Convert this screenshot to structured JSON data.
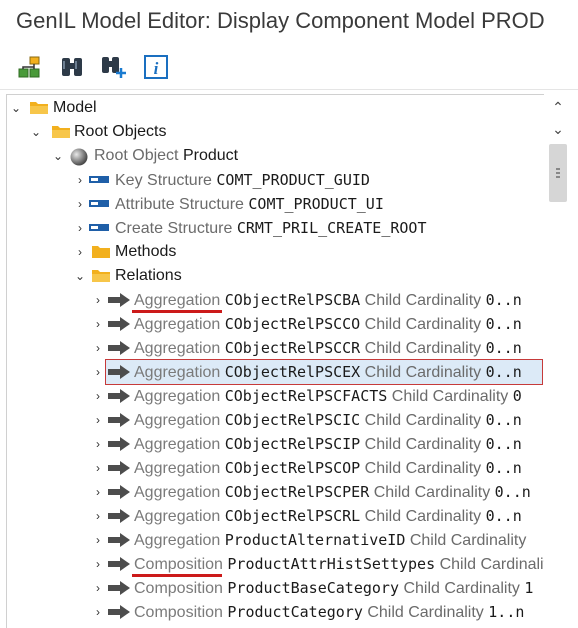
{
  "window": {
    "title": "GenIL Model Editor: Display Component Model PROD"
  },
  "toolbar": {
    "buttons": [
      {
        "name": "hierarchy-icon"
      },
      {
        "name": "binoculars-icon"
      },
      {
        "name": "binoculars-plus-icon"
      },
      {
        "name": "info-icon"
      }
    ]
  },
  "tree": {
    "model": "Model",
    "root_objects": "Root Objects",
    "root_object_kind": "Root Object",
    "root_object_name": "Product",
    "key_kind": "Key Structure",
    "key_val": "COMT_PRODUCT_GUID",
    "attr_kind": "Attribute Structure",
    "attr_val": "COMT_PRODUCT_UI",
    "create_kind": "Create Structure",
    "create_val": "CRMT_PRIL_CREATE_ROOT",
    "methods": "Methods",
    "relations": "Relations",
    "cardinality_label": "Child Cardinality",
    "items": [
      {
        "kind": "Aggregation",
        "name": "CObjectRelPSCBA",
        "card": "0..n"
      },
      {
        "kind": "Aggregation",
        "name": "CObjectRelPSCCO",
        "card": "0..n"
      },
      {
        "kind": "Aggregation",
        "name": "CObjectRelPSCCR",
        "card": "0..n"
      },
      {
        "kind": "Aggregation",
        "name": "CObjectRelPSCEX",
        "card": "0..n"
      },
      {
        "kind": "Aggregation",
        "name": "CObjectRelPSCFACTS",
        "card": "0"
      },
      {
        "kind": "Aggregation",
        "name": "CObjectRelPSCIC",
        "card": "0..n"
      },
      {
        "kind": "Aggregation",
        "name": "CObjectRelPSCIP",
        "card": "0..n"
      },
      {
        "kind": "Aggregation",
        "name": "CObjectRelPSCOP",
        "card": "0..n"
      },
      {
        "kind": "Aggregation",
        "name": "CObjectRelPSCPER",
        "card": "0..n"
      },
      {
        "kind": "Aggregation",
        "name": "CObjectRelPSCRL",
        "card": "0..n"
      },
      {
        "kind": "Aggregation",
        "name": "ProductAlternativeID",
        "card": ""
      },
      {
        "kind": "Composition",
        "name": "ProductAttrHistSettypes",
        "card": ""
      },
      {
        "kind": "Composition",
        "name": "ProductBaseCategory",
        "card": "1"
      },
      {
        "kind": "Composition",
        "name": "ProductCategory",
        "card": "1..n"
      }
    ]
  },
  "colors": {
    "selection_bg": "#dceaf7",
    "selection_border": "#c63a3a",
    "underline": "#cc1a1a",
    "folder": "#f2b01e"
  }
}
